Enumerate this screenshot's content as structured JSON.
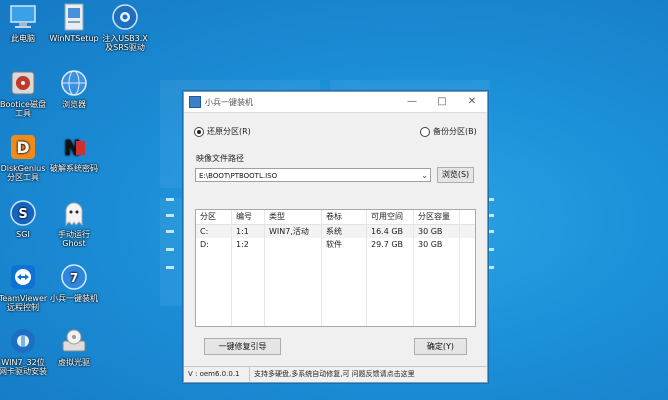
{
  "desktop": {
    "icons": [
      {
        "label": "此电脑",
        "icon": "computer-icon"
      },
      {
        "label": "WinNTSetup",
        "icon": "setup-icon"
      },
      {
        "label": "注入USB3.X\n及SRS驱动",
        "icon": "usb-gear-icon"
      },
      {
        "label": "Bootice磁盘\n工具",
        "icon": "bootice-icon"
      },
      {
        "label": "浏览器",
        "icon": "browser-icon"
      },
      {
        "label": "DiskGenius\n分区工具",
        "icon": "diskgenius-icon"
      },
      {
        "label": "破解系统密码",
        "icon": "password-icon"
      },
      {
        "label": "SGI",
        "icon": "sgi-icon"
      },
      {
        "label": "手动运行\nGhost",
        "icon": "ghost-icon"
      },
      {
        "label": "TeamViewer\n远程控制",
        "icon": "teamviewer-icon"
      },
      {
        "label": "小兵一键装机",
        "icon": "installer-icon"
      },
      {
        "label": "WIN7_32位\n网卡驱动安装",
        "icon": "network-driver-icon"
      },
      {
        "label": "虚拟光驱",
        "icon": "virtual-drive-icon"
      }
    ]
  },
  "dialog": {
    "title": "小兵一键装机",
    "restore_label": "还原分区(R)",
    "backup_label": "备份分区(B)",
    "image_path_label": "映像文件路径",
    "image_path_value": "E:\\BOOT\\PTBOOTL.ISO",
    "browse_button": "浏览(S)",
    "table": {
      "headers": [
        "分区",
        "编号",
        "类型",
        "卷标",
        "可用空间",
        "分区容量",
        ""
      ],
      "rows": [
        [
          "C:",
          "1:1",
          "WIN7,活动",
          "系统",
          "16.4 GB",
          "30 GB",
          ""
        ],
        [
          "D:",
          "1:2",
          "",
          "软件",
          "29.7 GB",
          "30 GB",
          ""
        ]
      ]
    },
    "repair_button": "一键修复引导",
    "ok_button": "确定(Y)",
    "status_version": "V : oem6.0.0.1",
    "status_message": "支持多硬盘,多系统自动修复,可 问题反馈请点击这里"
  }
}
